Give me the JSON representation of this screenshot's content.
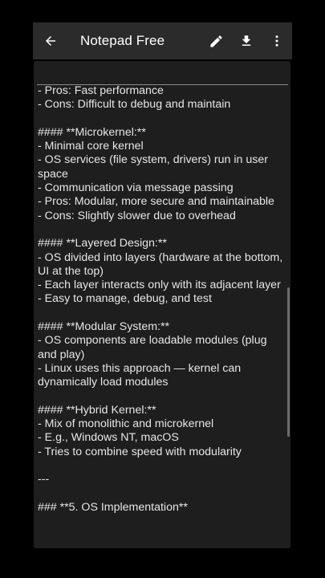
{
  "appbar": {
    "title": "Notepad Free",
    "back_icon": "arrow-left-icon",
    "edit_icon": "pencil-icon",
    "save_icon": "download-icon",
    "menu_icon": "more-vert-icon"
  },
  "colors": {
    "background": "#000000",
    "appbar": "#2b2b2b",
    "editor": "#1e1e1e",
    "text": "#e6e6e6"
  },
  "note": {
    "lines": [
      "- Pros: Fast performance",
      "- Cons: Difficult to debug and maintain",
      "",
      "#### **Microkernel:**",
      "- Minimal core kernel",
      "- OS services (file system, drivers) run in user space",
      "- Communication via message passing",
      "- Pros: Modular, more secure and maintainable",
      "- Cons: Slightly slower due to overhead",
      "",
      "#### **Layered Design:**",
      "- OS divided into layers (hardware at the bottom, UI at the top)",
      "- Each layer interacts only with its adjacent layer",
      "- Easy to manage, debug, and test",
      "",
      "#### **Modular System:**",
      "- OS components are loadable modules (plug and play)",
      "- Linux uses this approach — kernel can dynamically load modules",
      "",
      "#### **Hybrid Kernel:**",
      "- Mix of monolithic and microkernel",
      "- E.g., Windows NT, macOS",
      "- Tries to combine speed with modularity",
      "",
      "---",
      "",
      "### **5. OS Implementation**"
    ]
  }
}
